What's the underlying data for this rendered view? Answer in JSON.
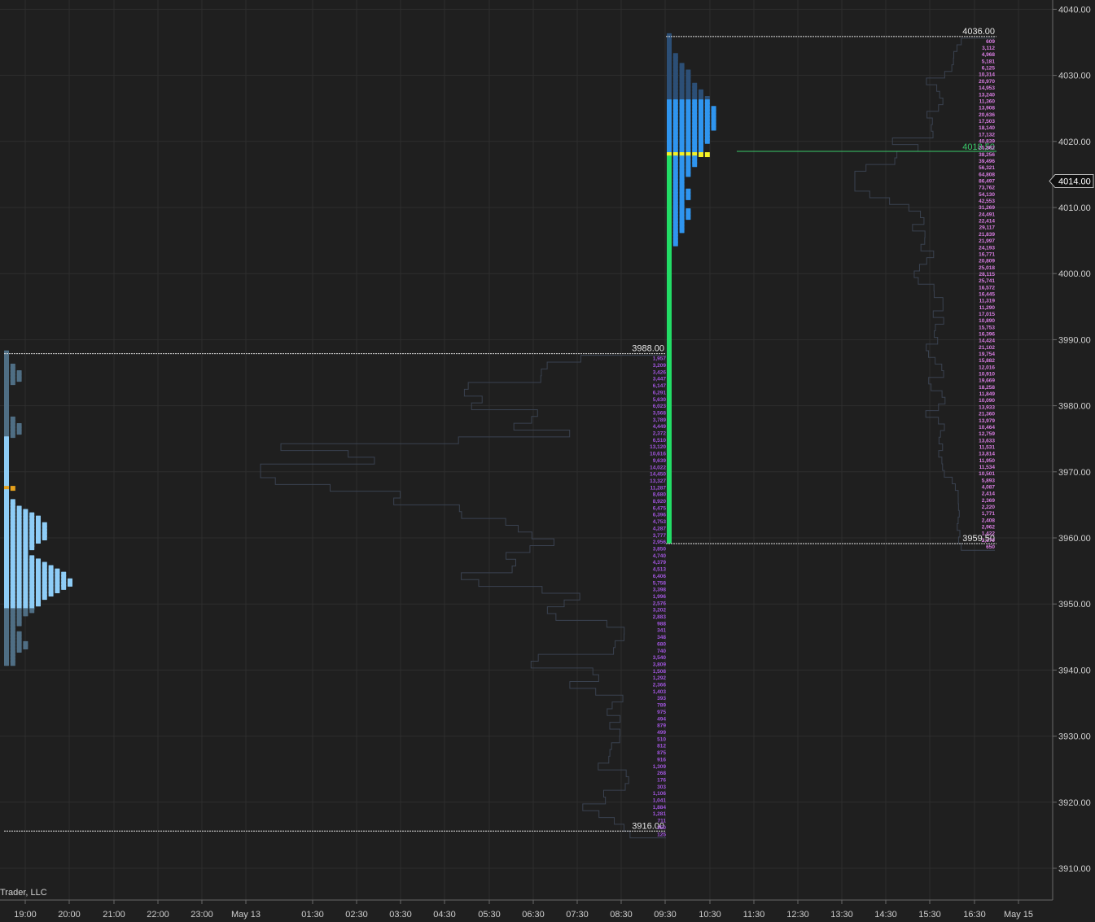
{
  "colors": {
    "background": "#1f1f1f",
    "grid": "#2e2e2e",
    "axis_text": "#cfcfcf",
    "overnight_profile": "#8ecdf7",
    "overnight_tail": "#4f6e84",
    "overnight_poc": "#e6a11c",
    "rth_profile": "#2f95ef",
    "rth_tail": "#2c4f76",
    "rth_poc": "#f4f227",
    "ib_column": "#22dd66",
    "volume_label_left": "#a356e0",
    "volume_label_right": "#dd7fe6",
    "volume_outline": "#3a4250",
    "poc_line": "#39c86a",
    "level_line": "#e0e0e0",
    "price_marker_bg": "#111111"
  },
  "watermark": "Trader, LLC",
  "chart_data": {
    "type": "market-profile",
    "x_axis": {
      "tick_labels": [
        "19:00",
        "20:00",
        "21:00",
        "22:00",
        "23:00",
        "May 13",
        "01:30",
        "02:30",
        "03:30",
        "04:30",
        "05:30",
        "06:30",
        "07:30",
        "08:30",
        "09:30",
        "10:30",
        "11:30",
        "12:30",
        "13:30",
        "14:30",
        "15:30",
        "16:30",
        "May 15"
      ]
    },
    "y_axis": {
      "range": [
        3905,
        4042
      ],
      "tick_step": 10,
      "tick_labels": [
        "3910.00",
        "3920.00",
        "3930.00",
        "3940.00",
        "3950.00",
        "3960.00",
        "3970.00",
        "3980.00",
        "3990.00",
        "4000.00",
        "4010.00",
        "4020.00",
        "4030.00",
        "4040.00"
      ],
      "current_price": "4014.00"
    },
    "profiles": [
      {
        "name": "overnight",
        "high": 3988.0,
        "low": 3916.0,
        "poc": 3967.5,
        "high_label": "3988.00",
        "low_label": "3916.00",
        "tpo_counts": [
          1,
          1,
          1,
          1,
          2,
          2,
          3,
          3,
          3,
          2,
          1,
          1,
          1,
          1,
          1,
          1,
          1,
          1,
          1,
          1,
          2,
          2,
          3,
          3,
          3,
          2,
          1,
          1,
          1,
          1,
          1,
          1,
          1,
          1,
          1,
          1,
          1,
          1,
          1,
          1,
          1,
          1,
          1,
          1,
          1,
          2,
          2,
          3,
          4,
          5,
          6,
          6,
          7,
          7,
          7,
          7,
          7,
          6,
          5,
          5,
          4,
          4,
          5,
          6,
          7,
          8,
          9,
          10,
          10,
          11,
          11,
          10,
          9,
          8,
          7,
          6,
          6,
          5,
          5,
          4,
          3,
          3,
          3,
          2,
          2,
          3,
          3,
          3,
          4,
          4,
          3,
          2,
          2,
          2,
          2
        ],
        "volume_labels": [
          "1,957",
          "3,209",
          "3,426",
          "3,447",
          "6,147",
          "6,291",
          "5,630",
          "6,023",
          "3,568",
          "3,789",
          "4,449",
          "2,372",
          "6,510",
          "13,120",
          "10,616",
          "9,639",
          "14,022",
          "14,450",
          "13,327",
          "11,287",
          "8,680",
          "8,920",
          "6,475",
          "6,396",
          "4,753",
          "4,287",
          "3,777",
          "2,956",
          "3,850",
          "4,740",
          "4,379",
          "4,513",
          "6,406",
          "5,758",
          "3,398",
          "1,996",
          "2,576",
          "3,202",
          "2,883",
          "988",
          "341",
          "348",
          "680",
          "740",
          "3,540",
          "3,809",
          "1,508",
          "1,292",
          "2,366",
          "1,403",
          "393",
          "789",
          "975",
          "494",
          "879",
          "499",
          "510",
          "812",
          "875",
          "916",
          "1,309",
          "268",
          "176",
          "303",
          "1,106",
          "1,041",
          "1,884",
          "1,281",
          "711",
          "350",
          "125"
        ]
      },
      {
        "name": "rth",
        "high": 4036.0,
        "low": 3959.5,
        "poc": 4018.0,
        "high_label": "4036.00",
        "low_label": "3959.50",
        "poc_label": "4018.50",
        "tpo_counts": [
          1,
          1,
          1,
          1,
          1,
          1,
          2,
          2,
          2,
          3,
          3,
          4,
          4,
          4,
          4,
          5,
          5,
          6,
          6,
          7,
          7,
          7,
          8,
          8,
          8,
          8,
          8,
          8,
          8,
          7,
          7,
          7,
          7,
          6,
          6,
          6,
          6,
          5,
          5,
          5,
          4,
          4,
          4,
          3,
          3,
          3,
          3,
          4,
          4,
          4,
          3,
          3,
          3,
          4,
          4,
          4,
          3,
          3,
          3,
          3,
          2,
          2,
          2,
          2,
          1,
          1,
          1,
          1,
          1,
          1,
          1,
          1,
          1,
          1,
          1,
          1,
          1,
          1,
          1,
          1,
          1,
          1,
          1,
          1,
          1,
          1,
          1,
          1,
          1,
          1,
          1,
          1,
          1,
          1,
          1,
          1,
          1,
          1,
          1,
          1,
          1,
          1,
          1,
          1,
          1,
          1,
          1,
          1,
          1,
          1,
          1,
          1,
          1,
          1,
          1,
          1,
          1,
          1,
          1,
          1,
          1,
          1,
          1,
          1,
          1,
          1,
          1,
          1,
          1,
          1,
          1,
          1,
          1,
          1,
          1,
          1,
          1,
          1,
          1,
          1,
          1,
          1,
          1,
          1,
          1,
          1,
          1,
          1,
          1,
          1,
          1,
          1,
          1,
          1
        ],
        "volume_labels": [
          "609",
          "3,112",
          "4,968",
          "5,181",
          "6,125",
          "10,314",
          "20,970",
          "14,953",
          "13,240",
          "11,360",
          "13,908",
          "20,636",
          "17,503",
          "18,140",
          "17,132",
          "40,839",
          "25,882",
          "38,256",
          "39,496",
          "56,321",
          "64,808",
          "86,497",
          "73,762",
          "54,130",
          "42,553",
          "31,269",
          "24,491",
          "22,414",
          "29,117",
          "21,839",
          "21,997",
          "24,193",
          "16,771",
          "20,809",
          "25,018",
          "28,115",
          "25,741",
          "16,572",
          "16,445",
          "11,319",
          "11,290",
          "17,015",
          "10,890",
          "15,753",
          "16,396",
          "14,424",
          "21,102",
          "19,754",
          "15,882",
          "12,016",
          "10,910",
          "19,669",
          "18,258",
          "11,849",
          "10,090",
          "13,933",
          "21,360",
          "13,979",
          "10,464",
          "12,759",
          "13,633",
          "11,531",
          "13,814",
          "11,950",
          "11,534",
          "10,501",
          "5,893",
          "4,087",
          "2,414",
          "2,369",
          "2,220",
          "1,771",
          "2,408",
          "2,962",
          "1,422",
          "2,170",
          "650"
        ]
      }
    ]
  }
}
